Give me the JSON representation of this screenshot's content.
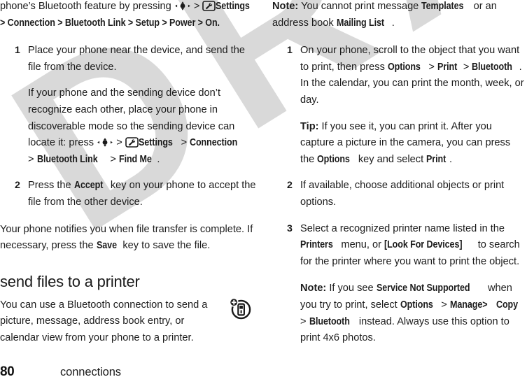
{
  "document": {
    "type": "phone-user-guide-page",
    "watermark": "DRAFT",
    "watermark_color": "#d9d9d9"
  },
  "footer": {
    "page_number": "80",
    "section": "connections"
  },
  "icons": {
    "nav_key": "navigation-key-icon",
    "settings": "settings-wrench-icon",
    "margin_bluetooth": "bluetooth-send-device-icon"
  },
  "left_column": {
    "intro": {
      "line1_pre": "phone’s Bluetooth feature by pressing ",
      "line1_sep": " > ",
      "settings_label": "Settings",
      "line2": "> Connection > Bluetooth Link > Setup > Power > On.",
      "line2_parts": [
        "Connection",
        "Bluetooth Link",
        "Setup",
        "Power",
        "On"
      ]
    },
    "step1": {
      "number": "1",
      "text": "Place your phone near the device, and send the file from the device.",
      "sub_pre": "If your phone and the sending device don’t recognize each other, place your phone in discoverable mode so the sending device can locate it: press ",
      "sub_sep": " > ",
      "sub_settings": "Settings",
      "sub_mid": " > ",
      "sub_connection": "Connection",
      "sub_line_last_pre": "> ",
      "sub_bluetooth_link": "Bluetooth Link",
      "sub_gt": " > ",
      "sub_find_me": "Find Me",
      "sub_period": "."
    },
    "step2": {
      "number": "2",
      "pre": "Press the ",
      "key": "Accept",
      "post": " key on your phone to accept the file from the other device."
    },
    "after_steps": {
      "pre": "Your phone notifies you when file transfer is complete. If necessary, press the ",
      "key": "Save",
      "post": " key to save the file."
    },
    "section_heading": "send files to a printer",
    "section_body": "You can use a Bluetooth connection to send a picture, message, address book entry, or calendar view from your phone to a printer."
  },
  "right_column": {
    "note1": {
      "label": "Note:",
      "pre": " You cannot print message ",
      "b1": "Templates",
      "mid": " or an address book ",
      "b2": "Mailing List",
      "post": "."
    },
    "step1": {
      "number": "1",
      "pre": "On your phone, scroll to the object that you want to print, then press ",
      "b1": "Options",
      "s1": " > ",
      "b2": "Print",
      "s2": " > ",
      "b3": "Bluetooth",
      "post": ". In the calendar, you can print the month, week, or day.",
      "tip": {
        "label": "Tip:",
        "pre": " If you see it, you can print it. After you capture a picture in the camera, you can press the ",
        "b1": "Options",
        "mid": " key and select ",
        "b2": "Print",
        "post": "."
      }
    },
    "step2": {
      "number": "2",
      "text": "If available, choose additional objects or print options."
    },
    "step3": {
      "number": "3",
      "pre": "Select a recognized printer name listed in the ",
      "b1": "Printers",
      "mid": " menu, or ",
      "b2": "[Look For Devices]",
      "post": " to search for the printer where you want to print the object."
    },
    "note2": {
      "label": "Note:",
      "pre": " If you see ",
      "b1": "Service Not Supported",
      "mid": " when you try to print, select ",
      "b2": "Options",
      "s1": " > ",
      "b3": "Manage>",
      "s2": " ",
      "b4": "Copy",
      "s3": " > ",
      "b5": "Bluetooth",
      "post": " instead. Always use this option to print 4x6 photos."
    }
  }
}
